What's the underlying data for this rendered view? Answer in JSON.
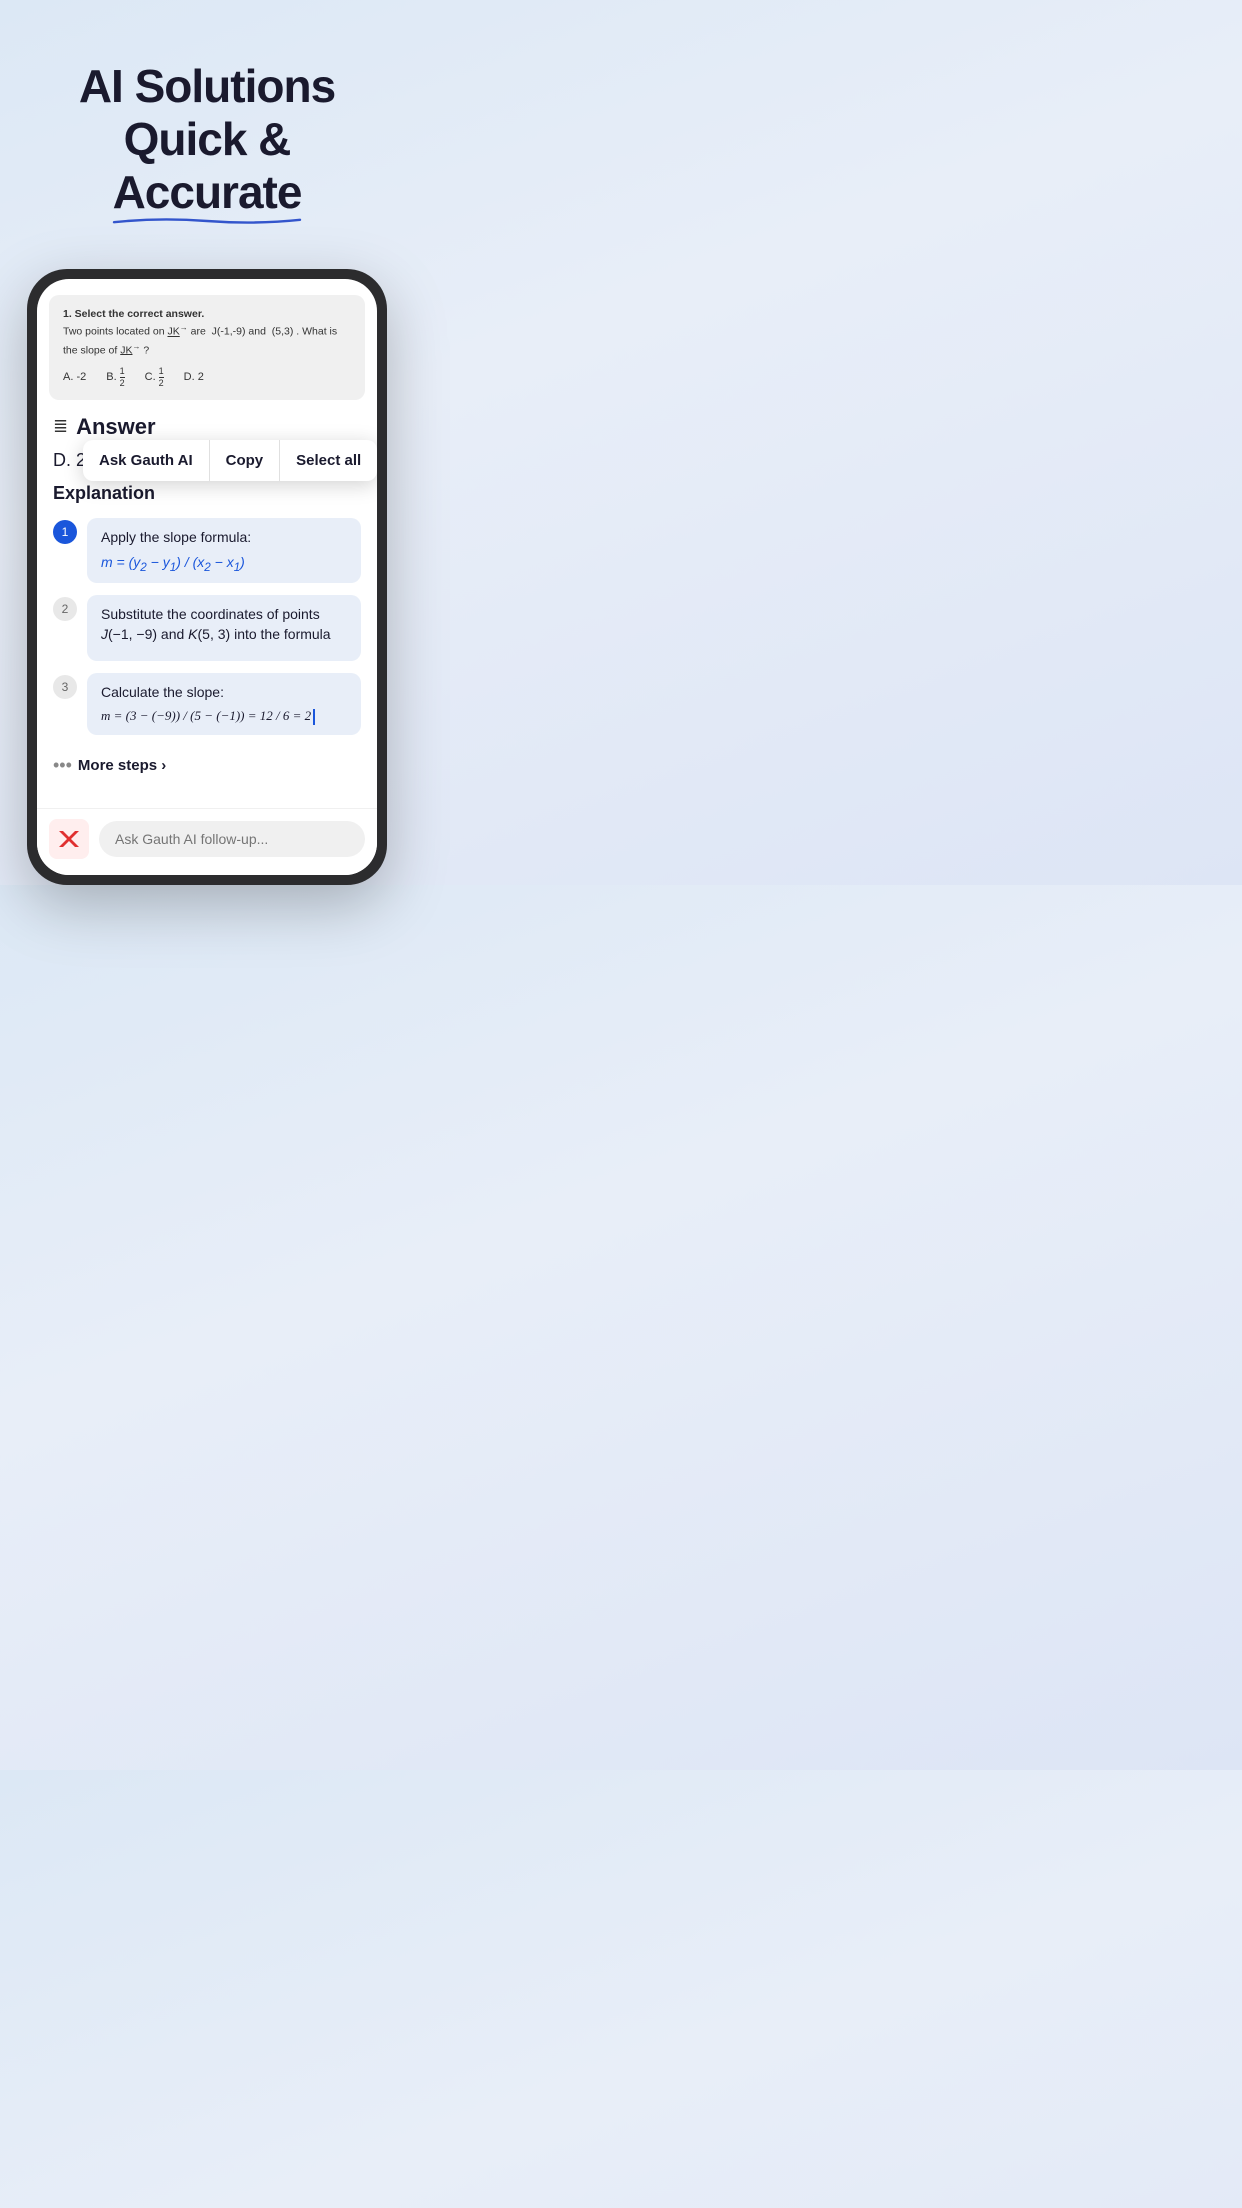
{
  "hero": {
    "line1": "AI Solutions",
    "line2": "Quick & Accurate"
  },
  "question": {
    "number": "1.",
    "instruction": "Select the correct answer.",
    "problem": "Two points located on JK are J(-1,-9) and (5,3). What is the slope of JK?",
    "choices": [
      {
        "label": "A.",
        "value": "-2"
      },
      {
        "label": "B.",
        "num": "1",
        "den": "2"
      },
      {
        "label": "C.",
        "num": "1",
        "den": "2"
      },
      {
        "label": "D.",
        "value": "2"
      }
    ]
  },
  "answer": {
    "icon_label": "≡+",
    "section_title": "Answer",
    "value": "D. 2"
  },
  "context_menu": {
    "items": [
      "Ask Gauth AI",
      "Copy",
      "Select all"
    ]
  },
  "explanation": {
    "title": "Explanation",
    "steps": [
      {
        "number": "1",
        "text": "Apply the slope formula:",
        "formula": "m = (y₂ − y₁) / (x₂ − x₁)"
      },
      {
        "number": "2",
        "text": "Substitute the coordinates of points J(−1, −9) and K(5, 3) into the formula",
        "formula": ""
      },
      {
        "number": "3",
        "text": "Calculate the slope:",
        "formula": "m = (3 − (−9)) / (5 − (−1)) = 12 / 6 = 2"
      }
    ],
    "more_steps": "More steps ›"
  },
  "bottom_bar": {
    "placeholder": "Ask Gauth AI follow-up..."
  }
}
